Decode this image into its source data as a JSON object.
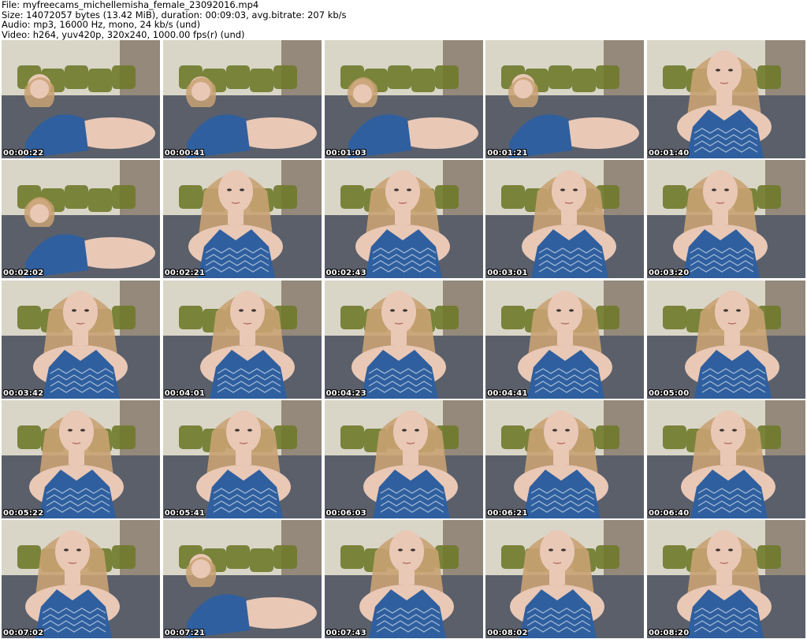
{
  "header": {
    "file_line": "File: myfreecams_michellemisha_female_23092016.mp4",
    "size_line": "Size: 14072057 bytes (13.42 MiB), duration: 00:09:03, avg.bitrate: 207 kb/s",
    "audio_line": "Audio: mp3, 16000 Hz, mono, 24 kb/s (und)",
    "video_line": "Video: h264, yuv420p, 320x240, 1000.00 fps(r) (und)"
  },
  "thumbnails": [
    {
      "timestamp": "00:00:22",
      "pose": "recline"
    },
    {
      "timestamp": "00:00:41",
      "pose": "recline"
    },
    {
      "timestamp": "00:01:03",
      "pose": "recline"
    },
    {
      "timestamp": "00:01:21",
      "pose": "recline"
    },
    {
      "timestamp": "00:01:40",
      "pose": "close"
    },
    {
      "timestamp": "00:02:02",
      "pose": "recline"
    },
    {
      "timestamp": "00:02:21",
      "pose": "close"
    },
    {
      "timestamp": "00:02:43",
      "pose": "close"
    },
    {
      "timestamp": "00:03:01",
      "pose": "close"
    },
    {
      "timestamp": "00:03:20",
      "pose": "close"
    },
    {
      "timestamp": "00:03:42",
      "pose": "close"
    },
    {
      "timestamp": "00:04:01",
      "pose": "close"
    },
    {
      "timestamp": "00:04:23",
      "pose": "close"
    },
    {
      "timestamp": "00:04:41",
      "pose": "close"
    },
    {
      "timestamp": "00:05:00",
      "pose": "close"
    },
    {
      "timestamp": "00:05:22",
      "pose": "close"
    },
    {
      "timestamp": "00:05:41",
      "pose": "close"
    },
    {
      "timestamp": "00:06:03",
      "pose": "close"
    },
    {
      "timestamp": "00:06:21",
      "pose": "close"
    },
    {
      "timestamp": "00:06:40",
      "pose": "close"
    },
    {
      "timestamp": "00:07:02",
      "pose": "close"
    },
    {
      "timestamp": "00:07:21",
      "pose": "recline"
    },
    {
      "timestamp": "00:07:43",
      "pose": "close"
    },
    {
      "timestamp": "00:08:02",
      "pose": "close"
    },
    {
      "timestamp": "00:08:20",
      "pose": "close"
    }
  ],
  "colors": {
    "page_background": "#ffffff",
    "header_text": "#000000",
    "timestamp_text": "#ffffff",
    "timestamp_outline": "#000000",
    "wall": "#d9d6c8",
    "cushion_green": "#6f7a2a",
    "dress_blue": "#2f5f9e",
    "skin": "#e9c8b6",
    "hair": "#c9a273",
    "bed": "#5a5f6a"
  }
}
